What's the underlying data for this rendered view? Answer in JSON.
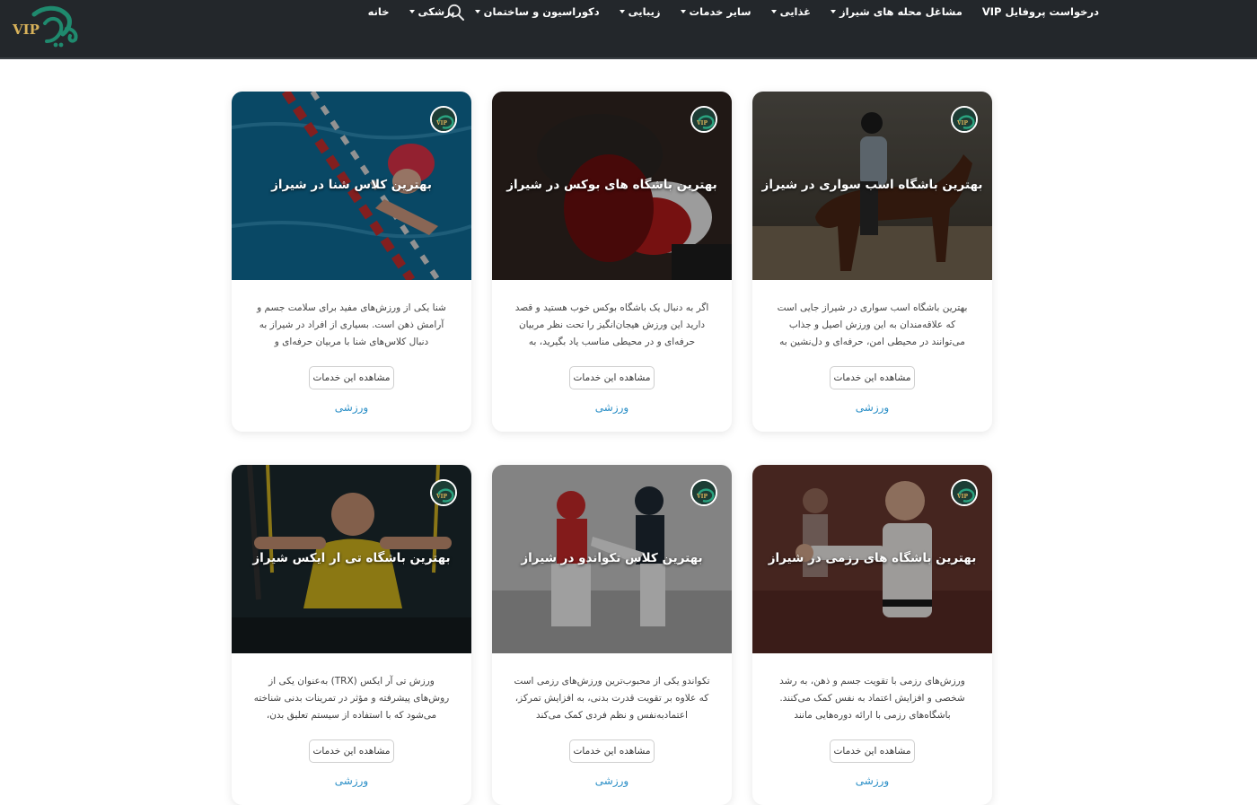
{
  "nav": {
    "items": [
      {
        "label": "خانه",
        "dropdown": false
      },
      {
        "label": "پزشکی",
        "dropdown": true
      },
      {
        "label": "دکوراسیون و ساختمان",
        "dropdown": true
      },
      {
        "label": "زیبایی",
        "dropdown": true
      },
      {
        "label": "سایر خدمات",
        "dropdown": true
      },
      {
        "label": "غذایی",
        "dropdown": true
      },
      {
        "label": "مشاغل محله های شیراز",
        "dropdown": true
      },
      {
        "label": "درخواست پروفایل VIP",
        "dropdown": false
      }
    ]
  },
  "logo": {
    "text": "VIP"
  },
  "colors": {
    "topbar": "#23272b",
    "accent": "#2b8fc7",
    "logo_green": "#1f8a6e",
    "logo_gold": "#d8b25a"
  },
  "cards": [
    {
      "title": "بهترین باشگاه اسب سواری در شیراز",
      "desc": "بهترین باشگاه اسب سواری در شیراز جایی است که علاقه‌مندان به این ورزش اصیل و جذاب می‌توانند در محیطی امن، حرفه‌ای و دل‌نشین به",
      "button": "مشاهده این خدمات",
      "category": "ورزشی",
      "scene": "horse"
    },
    {
      "title": "بهترین باشگاه های بوکس در شیراز",
      "desc": "اگر به دنبال یک باشگاه بوکس خوب هستید و قصد دارید این ورزش هیجان‌انگیز را تحت نظر مربیان حرفه‌ای و در محیطی مناسب یاد بگیرید، به",
      "button": "مشاهده این خدمات",
      "category": "ورزشی",
      "scene": "boxing"
    },
    {
      "title": "بهترین کلاس شنا در شیراز",
      "desc": "شنا یکی از ورزش‌های مفید برای سلامت جسم و آرامش ذهن است. بسیاری از افراد در شیراز به دنبال کلاس‌های شنا با مربیان حرفه‌ای و",
      "button": "مشاهده این خدمات",
      "category": "ورزشی",
      "scene": "swim"
    },
    {
      "title": "بهترین باشگاه های رزمی در شیراز",
      "desc": "ورزش‌های رزمی با تقویت جسم و ذهن، به رشد شخصی و افزایش اعتماد به نفس کمک می‌کنند. باشگاه‌های رزمی با ارائه دوره‌هایی مانند",
      "button": "مشاهده این خدمات",
      "category": "ورزشی",
      "scene": "martial"
    },
    {
      "title": "بهترین کلاس تکواندو در شیراز",
      "desc": "تکواندو یکی از محبوب‌ترین ورزش‌های رزمی است که علاوه بر تقویت قدرت بدنی، به افزایش تمرکز، اعتمادبه‌نفس و نظم فردی کمک می‌کند",
      "button": "مشاهده این خدمات",
      "category": "ورزشی",
      "scene": "taekwondo"
    },
    {
      "title": "بهترین باشگاه تی ار ایکس شیراز",
      "desc": "ورزش تی آر ایکس (TRX) به‌عنوان یکی از روش‌های پیشرفته و مؤثر در تمرینات بدنی شناخته می‌شود که با استفاده از سیستم تعلیق بدن، تمرینات",
      "button": "مشاهده این خدمات",
      "category": "ورزشی",
      "scene": "trx"
    }
  ]
}
